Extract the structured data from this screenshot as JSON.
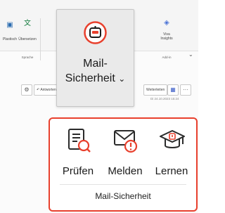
{
  "ribbon": {
    "items": [
      {
        "label": "Plastisch",
        "icon": "office-icon"
      },
      {
        "label": "Übersetzen",
        "icon": "translate-icon"
      }
    ],
    "group_language": "Sprache",
    "viva": {
      "line1": "Viva",
      "line2": "Insights",
      "icon": "viva-insights-icon"
    },
    "group_addin": "Add-in"
  },
  "popup_button": {
    "label_line1": "Mail-",
    "label_line2": "Sicherheit",
    "chevron": "⌄",
    "icon": "mail-security-logo"
  },
  "message_bar": {
    "answer_label": "Antworten",
    "forward_label": "Weiterleiten",
    "date": "Di 24.10.2023 15:24",
    "more": "···"
  },
  "mail_security_group": {
    "title": "Mail-Sicherheit",
    "actions": [
      {
        "label": "Prüfen",
        "icon": "document-search-icon"
      },
      {
        "label": "Melden",
        "icon": "mail-warning-icon"
      },
      {
        "label": "Lernen",
        "icon": "graduation-cap-icon"
      }
    ],
    "accent": "#e8402d"
  }
}
